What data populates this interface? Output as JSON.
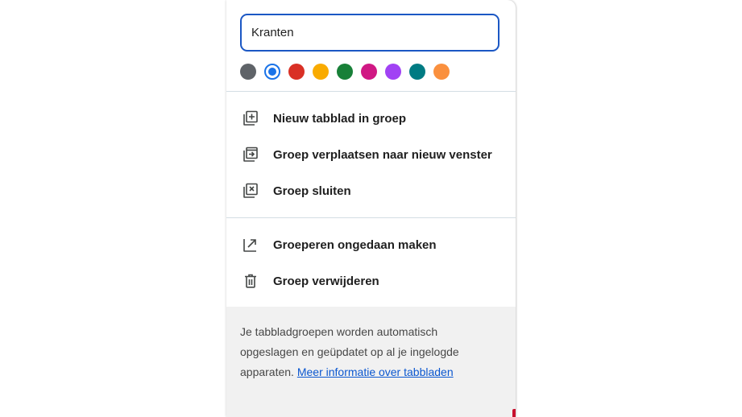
{
  "group_editor": {
    "name_value": "Kranten",
    "colors": [
      {
        "name": "grey",
        "hex": "#5f6368",
        "selected": false
      },
      {
        "name": "blue",
        "hex": "#1a73e8",
        "selected": true
      },
      {
        "name": "red",
        "hex": "#d93025",
        "selected": false
      },
      {
        "name": "yellow",
        "hex": "#f9ab00",
        "selected": false
      },
      {
        "name": "green",
        "hex": "#188038",
        "selected": false
      },
      {
        "name": "pink",
        "hex": "#d01884",
        "selected": false
      },
      {
        "name": "purple",
        "hex": "#a142f4",
        "selected": false
      },
      {
        "name": "cyan",
        "hex": "#007b83",
        "selected": false
      },
      {
        "name": "orange",
        "hex": "#fa903e",
        "selected": false
      }
    ]
  },
  "menu": {
    "new_tab": {
      "label": "Nieuw tabblad in groep",
      "icon": "new-tab-in-group-icon"
    },
    "move_group": {
      "label": "Groep verplaatsen naar nieuw venster",
      "icon": "move-to-window-icon"
    },
    "close_group": {
      "label": "Groep sluiten",
      "icon": "close-group-icon"
    },
    "ungroup": {
      "label": "Groeperen ongedaan maken",
      "icon": "ungroup-icon"
    },
    "delete_group": {
      "label": "Groep verwijderen",
      "icon": "trash-icon"
    }
  },
  "footer": {
    "text": "Je tabbladgroepen worden automatisch opgeslagen en geüpdatet op al je ingelogde apparaten.",
    "link": "Meer informatie over tabbladen"
  }
}
